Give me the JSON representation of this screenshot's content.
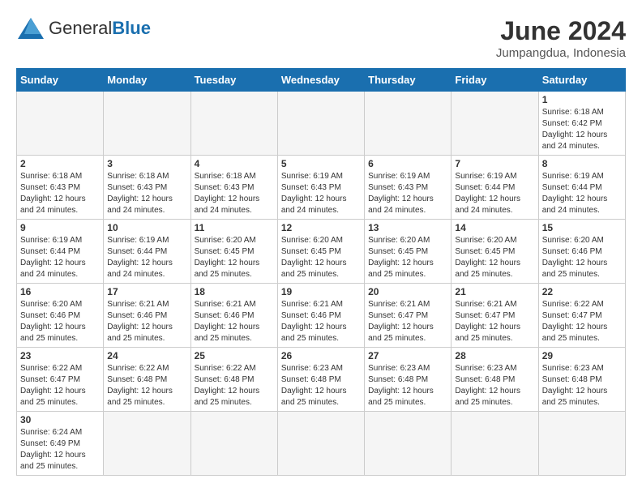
{
  "header": {
    "logo_general": "General",
    "logo_blue": "Blue",
    "month_title": "June 2024",
    "subtitle": "Jumpangdua, Indonesia"
  },
  "weekdays": [
    "Sunday",
    "Monday",
    "Tuesday",
    "Wednesday",
    "Thursday",
    "Friday",
    "Saturday"
  ],
  "weeks": [
    [
      {
        "day": "",
        "info": ""
      },
      {
        "day": "",
        "info": ""
      },
      {
        "day": "",
        "info": ""
      },
      {
        "day": "",
        "info": ""
      },
      {
        "day": "",
        "info": ""
      },
      {
        "day": "",
        "info": ""
      },
      {
        "day": "1",
        "info": "Sunrise: 6:18 AM\nSunset: 6:42 PM\nDaylight: 12 hours and 24 minutes."
      }
    ],
    [
      {
        "day": "2",
        "info": "Sunrise: 6:18 AM\nSunset: 6:43 PM\nDaylight: 12 hours and 24 minutes."
      },
      {
        "day": "3",
        "info": "Sunrise: 6:18 AM\nSunset: 6:43 PM\nDaylight: 12 hours and 24 minutes."
      },
      {
        "day": "4",
        "info": "Sunrise: 6:18 AM\nSunset: 6:43 PM\nDaylight: 12 hours and 24 minutes."
      },
      {
        "day": "5",
        "info": "Sunrise: 6:19 AM\nSunset: 6:43 PM\nDaylight: 12 hours and 24 minutes."
      },
      {
        "day": "6",
        "info": "Sunrise: 6:19 AM\nSunset: 6:43 PM\nDaylight: 12 hours and 24 minutes."
      },
      {
        "day": "7",
        "info": "Sunrise: 6:19 AM\nSunset: 6:44 PM\nDaylight: 12 hours and 24 minutes."
      },
      {
        "day": "8",
        "info": "Sunrise: 6:19 AM\nSunset: 6:44 PM\nDaylight: 12 hours and 24 minutes."
      }
    ],
    [
      {
        "day": "9",
        "info": "Sunrise: 6:19 AM\nSunset: 6:44 PM\nDaylight: 12 hours and 24 minutes."
      },
      {
        "day": "10",
        "info": "Sunrise: 6:19 AM\nSunset: 6:44 PM\nDaylight: 12 hours and 24 minutes."
      },
      {
        "day": "11",
        "info": "Sunrise: 6:20 AM\nSunset: 6:45 PM\nDaylight: 12 hours and 25 minutes."
      },
      {
        "day": "12",
        "info": "Sunrise: 6:20 AM\nSunset: 6:45 PM\nDaylight: 12 hours and 25 minutes."
      },
      {
        "day": "13",
        "info": "Sunrise: 6:20 AM\nSunset: 6:45 PM\nDaylight: 12 hours and 25 minutes."
      },
      {
        "day": "14",
        "info": "Sunrise: 6:20 AM\nSunset: 6:45 PM\nDaylight: 12 hours and 25 minutes."
      },
      {
        "day": "15",
        "info": "Sunrise: 6:20 AM\nSunset: 6:46 PM\nDaylight: 12 hours and 25 minutes."
      }
    ],
    [
      {
        "day": "16",
        "info": "Sunrise: 6:20 AM\nSunset: 6:46 PM\nDaylight: 12 hours and 25 minutes."
      },
      {
        "day": "17",
        "info": "Sunrise: 6:21 AM\nSunset: 6:46 PM\nDaylight: 12 hours and 25 minutes."
      },
      {
        "day": "18",
        "info": "Sunrise: 6:21 AM\nSunset: 6:46 PM\nDaylight: 12 hours and 25 minutes."
      },
      {
        "day": "19",
        "info": "Sunrise: 6:21 AM\nSunset: 6:46 PM\nDaylight: 12 hours and 25 minutes."
      },
      {
        "day": "20",
        "info": "Sunrise: 6:21 AM\nSunset: 6:47 PM\nDaylight: 12 hours and 25 minutes."
      },
      {
        "day": "21",
        "info": "Sunrise: 6:21 AM\nSunset: 6:47 PM\nDaylight: 12 hours and 25 minutes."
      },
      {
        "day": "22",
        "info": "Sunrise: 6:22 AM\nSunset: 6:47 PM\nDaylight: 12 hours and 25 minutes."
      }
    ],
    [
      {
        "day": "23",
        "info": "Sunrise: 6:22 AM\nSunset: 6:47 PM\nDaylight: 12 hours and 25 minutes."
      },
      {
        "day": "24",
        "info": "Sunrise: 6:22 AM\nSunset: 6:48 PM\nDaylight: 12 hours and 25 minutes."
      },
      {
        "day": "25",
        "info": "Sunrise: 6:22 AM\nSunset: 6:48 PM\nDaylight: 12 hours and 25 minutes."
      },
      {
        "day": "26",
        "info": "Sunrise: 6:23 AM\nSunset: 6:48 PM\nDaylight: 12 hours and 25 minutes."
      },
      {
        "day": "27",
        "info": "Sunrise: 6:23 AM\nSunset: 6:48 PM\nDaylight: 12 hours and 25 minutes."
      },
      {
        "day": "28",
        "info": "Sunrise: 6:23 AM\nSunset: 6:48 PM\nDaylight: 12 hours and 25 minutes."
      },
      {
        "day": "29",
        "info": "Sunrise: 6:23 AM\nSunset: 6:48 PM\nDaylight: 12 hours and 25 minutes."
      }
    ],
    [
      {
        "day": "30",
        "info": "Sunrise: 6:24 AM\nSunset: 6:49 PM\nDaylight: 12 hours and 25 minutes."
      },
      {
        "day": "",
        "info": ""
      },
      {
        "day": "",
        "info": ""
      },
      {
        "day": "",
        "info": ""
      },
      {
        "day": "",
        "info": ""
      },
      {
        "day": "",
        "info": ""
      },
      {
        "day": "",
        "info": ""
      }
    ]
  ]
}
